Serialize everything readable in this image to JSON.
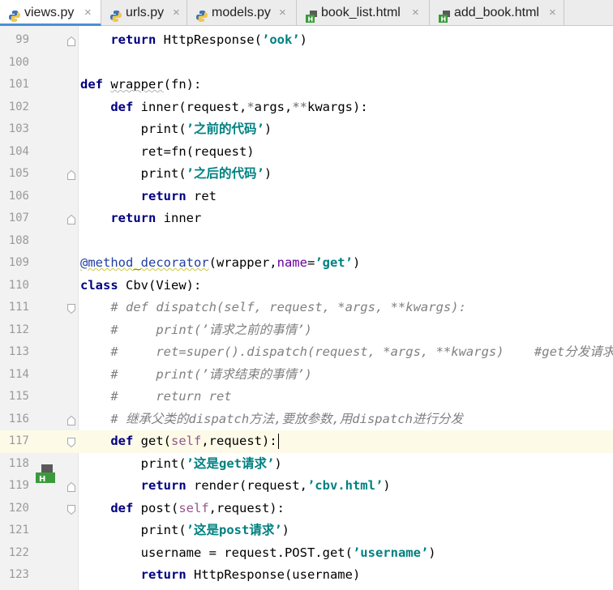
{
  "tabs": [
    {
      "label": "views.py",
      "type": "python",
      "active": true
    },
    {
      "label": "urls.py",
      "type": "python",
      "active": false
    },
    {
      "label": "models.py",
      "type": "python",
      "active": false
    },
    {
      "label": "book_list.html",
      "type": "html",
      "active": false
    },
    {
      "label": "add_book.html",
      "type": "html",
      "active": false
    }
  ],
  "close_glyph": "×",
  "current_line": 117,
  "lines": [
    {
      "n": "99",
      "tokens": [
        [
          "",
          "    "
        ],
        [
          "kw",
          "return"
        ],
        [
          "",
          " HttpResponse("
        ],
        [
          "str",
          "’ook’"
        ],
        [
          "",
          ")"
        ]
      ],
      "fold": "up"
    },
    {
      "n": "100",
      "tokens": []
    },
    {
      "n": "101",
      "tokens": [
        [
          "kw",
          "def"
        ],
        [
          "",
          " "
        ],
        [
          "squig",
          "wrapper"
        ],
        [
          "",
          "(fn):"
        ]
      ]
    },
    {
      "n": "102",
      "tokens": [
        [
          "",
          "    "
        ],
        [
          "kw",
          "def"
        ],
        [
          "",
          " inner(request,"
        ],
        [
          "star",
          "*"
        ],
        [
          "",
          "args,"
        ],
        [
          "star",
          "**"
        ],
        [
          "",
          "kwargs):"
        ]
      ]
    },
    {
      "n": "103",
      "tokens": [
        [
          "",
          "        print("
        ],
        [
          "str",
          "’之前的代码’"
        ],
        [
          "",
          ")"
        ]
      ]
    },
    {
      "n": "104",
      "tokens": [
        [
          "",
          "        ret=fn(request)"
        ]
      ]
    },
    {
      "n": "105",
      "tokens": [
        [
          "",
          "        print("
        ],
        [
          "str",
          "’之后的代码’"
        ],
        [
          "",
          ")"
        ]
      ],
      "fold": "up"
    },
    {
      "n": "106",
      "tokens": [
        [
          "",
          "        "
        ],
        [
          "kw",
          "return"
        ],
        [
          "",
          " ret"
        ]
      ]
    },
    {
      "n": "107",
      "tokens": [
        [
          "",
          "    "
        ],
        [
          "kw",
          "return"
        ],
        [
          "",
          " inner"
        ]
      ],
      "fold": "up"
    },
    {
      "n": "108",
      "tokens": []
    },
    {
      "n": "109",
      "tokens": [
        [
          "deco",
          "@method_decorator"
        ],
        [
          "",
          "(wrapper,"
        ],
        [
          "kwarg",
          "name"
        ],
        [
          "",
          "="
        ],
        [
          "str",
          "’get’"
        ],
        [
          "",
          ")"
        ]
      ]
    },
    {
      "n": "110",
      "tokens": [
        [
          "kw",
          "class"
        ],
        [
          "",
          " Cbv(View):"
        ]
      ]
    },
    {
      "n": "111",
      "tokens": [
        [
          "",
          "    "
        ],
        [
          "cmt",
          "# def dispatch(self, request, *args, **kwargs):"
        ]
      ],
      "fold": "down"
    },
    {
      "n": "112",
      "tokens": [
        [
          "",
          "    "
        ],
        [
          "cmt",
          "#     print(’请求之前的事情’)"
        ]
      ]
    },
    {
      "n": "113",
      "tokens": [
        [
          "",
          "    "
        ],
        [
          "cmt",
          "#     ret=super().dispatch(request, *args, **kwargs)    #get分发请求"
        ]
      ]
    },
    {
      "n": "114",
      "tokens": [
        [
          "",
          "    "
        ],
        [
          "cmt",
          "#     print(’请求结束的事情’)"
        ]
      ]
    },
    {
      "n": "115",
      "tokens": [
        [
          "",
          "    "
        ],
        [
          "cmt",
          "#     return ret"
        ]
      ]
    },
    {
      "n": "116",
      "tokens": [
        [
          "",
          "    "
        ],
        [
          "cmt",
          "# 继承父类的dispatch方法,要放参数,用dispatch进行分发"
        ]
      ],
      "fold": "up"
    },
    {
      "n": "117",
      "tokens": [
        [
          "",
          "    "
        ],
        [
          "kw",
          "def"
        ],
        [
          "",
          " get("
        ],
        [
          "self",
          "self"
        ],
        [
          "",
          ",request):"
        ]
      ],
      "fold": "down",
      "cursor": true
    },
    {
      "n": "118",
      "tokens": [
        [
          "",
          "        print("
        ],
        [
          "str",
          "’这是get请求’"
        ],
        [
          "",
          ")"
        ]
      ]
    },
    {
      "n": "119",
      "tokens": [
        [
          "",
          "        "
        ],
        [
          "kw",
          "return"
        ],
        [
          "",
          " render(request,"
        ],
        [
          "str",
          "’cbv.html’"
        ],
        [
          "",
          ")"
        ]
      ],
      "fold": "up",
      "html_marker": true
    },
    {
      "n": "120",
      "tokens": [
        [
          "",
          "    "
        ],
        [
          "kw",
          "def"
        ],
        [
          "",
          " post("
        ],
        [
          "self",
          "self"
        ],
        [
          "",
          ",request):"
        ]
      ],
      "fold": "down"
    },
    {
      "n": "121",
      "tokens": [
        [
          "",
          "        print("
        ],
        [
          "str",
          "’这是post请求’"
        ],
        [
          "",
          ")"
        ]
      ]
    },
    {
      "n": "122",
      "tokens": [
        [
          "",
          "        username = request.POST.get("
        ],
        [
          "str",
          "’username’"
        ],
        [
          "",
          ")"
        ]
      ]
    },
    {
      "n": "123",
      "tokens": [
        [
          "",
          "        "
        ],
        [
          "kw",
          "return"
        ],
        [
          "",
          " HttpResponse(username)"
        ]
      ]
    }
  ]
}
